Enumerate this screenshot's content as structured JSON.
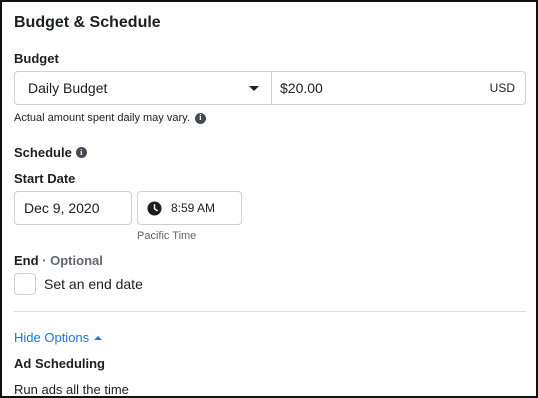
{
  "section": {
    "title": "Budget & Schedule"
  },
  "budget": {
    "label": "Budget",
    "type_value": "Daily Budget",
    "amount_value": "$20.00",
    "currency": "USD",
    "hint": "Actual amount spent daily may vary."
  },
  "schedule": {
    "label": "Schedule",
    "start_date_label": "Start Date",
    "date_value": "Dec 9, 2020",
    "time_value": "8:59 AM",
    "timezone": "Pacific Time",
    "end_label": "End",
    "end_optional": "· Optional",
    "set_end_date": "Set an end date"
  },
  "options": {
    "hide_options": "Hide Options",
    "ad_scheduling": "Ad Scheduling",
    "run_ads": "Run ads all the time"
  },
  "colors": {
    "link": "#1877f2",
    "border": "#ccd0d5",
    "muted": "#606770"
  },
  "icons": {
    "dropdown": "caret-down-icon",
    "info": "info-icon",
    "clock": "clock-icon",
    "collapse": "caret-up-icon"
  }
}
